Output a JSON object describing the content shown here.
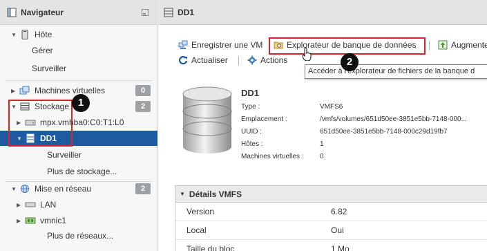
{
  "navigator": {
    "title": "Navigateur",
    "items": [
      {
        "label": "Hôte"
      },
      {
        "label": "Gérer"
      },
      {
        "label": "Surveiller"
      },
      {
        "label": "Machines virtuelles",
        "badge": "0"
      },
      {
        "label": "Stockage",
        "badge": "2"
      },
      {
        "label": "mpx.vmhba0:C0:T1:L0"
      },
      {
        "label": "DD1"
      },
      {
        "label": "Surveiller"
      },
      {
        "label": "Plus de stockage..."
      },
      {
        "label": "Mise en réseau",
        "badge": "2"
      },
      {
        "label": "LAN"
      },
      {
        "label": "vmnic1"
      },
      {
        "label": "Plus de réseaux..."
      }
    ]
  },
  "main": {
    "title": "DD1",
    "toolbar": {
      "register_vm": "Enregistrer une VM",
      "datastore_browser": "Explorateur de banque de données",
      "increase": "Augmente",
      "refresh": "Actualiser",
      "actions": "Actions"
    },
    "tooltip": "Accéder à l'explorateur de fichiers de la banque d",
    "datastore": {
      "name": "DD1",
      "props": [
        {
          "key": "Type :",
          "value": "VMFS6"
        },
        {
          "key": "Emplacement :",
          "value": "/vmfs/volumes/651d50ee-3851e5bb-7148-000..."
        },
        {
          "key": "UUID :",
          "value": "651d50ee-3851e5bb-7148-000c29d19fb7"
        },
        {
          "key": "Hôtes :",
          "value": "1"
        },
        {
          "key": "Machines virtuelles :",
          "value": "0"
        }
      ]
    },
    "vmfs": {
      "title": "Détails VMFS",
      "rows": [
        {
          "key": "Version",
          "value": "6.82"
        },
        {
          "key": "Local",
          "value": "Oui"
        },
        {
          "key": "Taille du bloc",
          "value": "1 Mo"
        }
      ]
    }
  },
  "annotations": {
    "marker1": "1",
    "marker2": "2",
    "color": "#d9242b"
  },
  "colors": {
    "selection": "#1d5aa0",
    "badge": "#9ea2a5",
    "highlight": "#d9242b"
  }
}
